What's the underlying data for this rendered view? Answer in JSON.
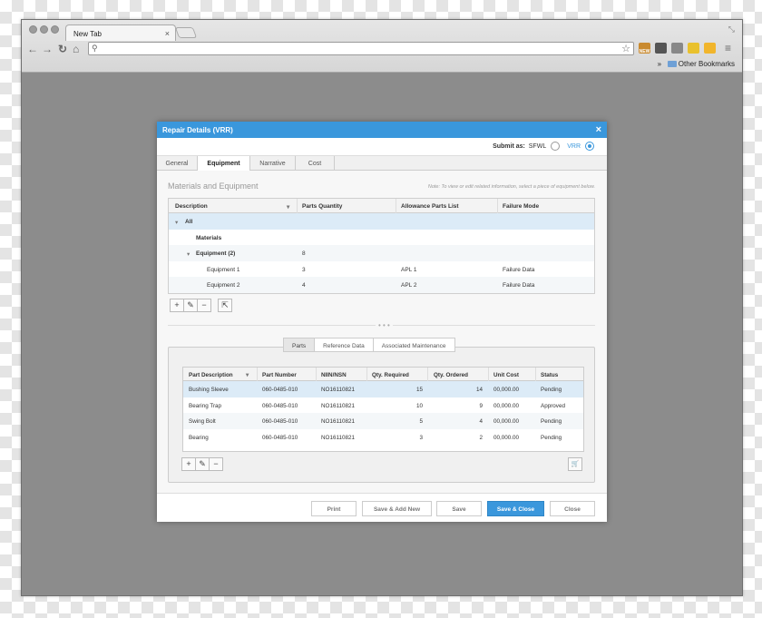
{
  "browser": {
    "tab_title": "New Tab",
    "tab_close": "×",
    "address_value": "",
    "bookmarks_chevron": "»",
    "bookmarks_label": "Other Bookmarks",
    "ext_badge": "NEW"
  },
  "dialog": {
    "title": "Repair Details (VRR)",
    "close": "×",
    "submit_label": "Submit as:",
    "submit_options": [
      {
        "label": "SFWL",
        "selected": false
      },
      {
        "label": "VRR",
        "selected": true
      }
    ],
    "tabs": [
      "General",
      "Equipment",
      "Narrative",
      "Cost"
    ],
    "active_tab": "Equipment",
    "section_title": "Materials and Equipment",
    "note": "Note: To view or edit related information, select a piece of equipment below.",
    "equipment_grid": {
      "columns": [
        "Description",
        "Parts Quantity",
        "Allowance Parts List",
        "Failure Mode"
      ],
      "rows": [
        {
          "description": "All",
          "qty": "",
          "apl": "",
          "failure": "",
          "expander": "▾"
        },
        {
          "description": "Materials",
          "qty": "",
          "apl": "",
          "failure": ""
        },
        {
          "description": "Equipment (2)",
          "qty": "8",
          "apl": "",
          "failure": "",
          "expander": "▾"
        },
        {
          "description": "Equipment 1",
          "qty": "3",
          "apl": "APL 1",
          "failure": "Failure Data"
        },
        {
          "description": "Equipment 2",
          "qty": "4",
          "apl": "APL 2",
          "failure": "Failure Data"
        }
      ]
    },
    "divider_dots": "• • •",
    "subtabs": [
      "Parts",
      "Reference Data",
      "Associated Maintenance"
    ],
    "active_subtab": "Parts",
    "parts_table": {
      "columns": [
        "Part Description",
        "Part Number",
        "NIIN/NSN",
        "Qty. Required",
        "Qty. Ordered",
        "Unit Cost",
        "Status"
      ],
      "rows": [
        {
          "desc": "Bushing Sleeve",
          "part": "060-0485-010",
          "niin": "NO16110821",
          "req": "15",
          "ord": "14",
          "cost": "00,000.00",
          "status": "Pending"
        },
        {
          "desc": "Bearing Trap",
          "part": "060-0485-010",
          "niin": "NO16110821",
          "req": "10",
          "ord": "9",
          "cost": "00,000.00",
          "status": "Approved"
        },
        {
          "desc": "Swing Bolt",
          "part": "060-0485-010",
          "niin": "NO16110821",
          "req": "5",
          "ord": "4",
          "cost": "00,000.00",
          "status": "Pending"
        },
        {
          "desc": "Bearing",
          "part": "060-0485-010",
          "niin": "NO16110821",
          "req": "3",
          "ord": "2",
          "cost": "00,000.00",
          "status": "Pending"
        }
      ]
    },
    "toolbar": {
      "add": "+",
      "edit": "✎",
      "remove": "−",
      "export": "⇱",
      "cart": "🛒"
    },
    "footer_buttons": [
      "Print",
      "Save & Add New",
      "Save",
      "Save & Close",
      "Close"
    ],
    "primary_color": "#3a97dc"
  }
}
